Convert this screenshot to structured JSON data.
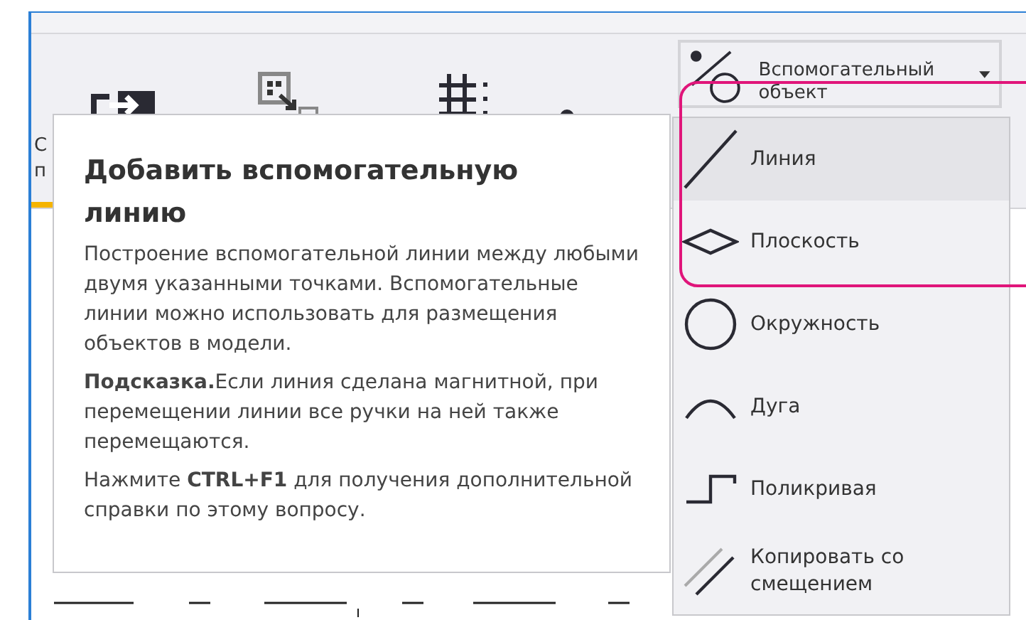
{
  "ribbon": {
    "cut_labels": [
      "С",
      "п"
    ]
  },
  "dropdown": {
    "label": "Вспомогательный объект",
    "expanded": true
  },
  "menu": [
    {
      "kind": "line",
      "label": "Линия",
      "selected": true
    },
    {
      "kind": "plane",
      "label": "Плоскость",
      "selected": false
    },
    {
      "kind": "circle",
      "label": "Окружность",
      "selected": false
    },
    {
      "kind": "arc",
      "label": "Дуга",
      "selected": false
    },
    {
      "kind": "polycurve",
      "label": "Поликривая",
      "selected": false
    },
    {
      "kind": "offset",
      "label": "Копировать со смещением",
      "selected": false
    }
  ],
  "tooltip": {
    "title": "Добавить вспомогательную линию",
    "paragraphs": [
      "Построение вспомогательной линии между любыми двумя указанными точками. Вспомогательные линии можно использовать для размещения объектов в модели.",
      "**Подсказка.**Если линия сделана магнитной, при перемещении линии все ручки на ней также перемещаются.",
      "Нажмите **CTRL+F1** для получения дополнительной справки по этому вопросу."
    ]
  }
}
